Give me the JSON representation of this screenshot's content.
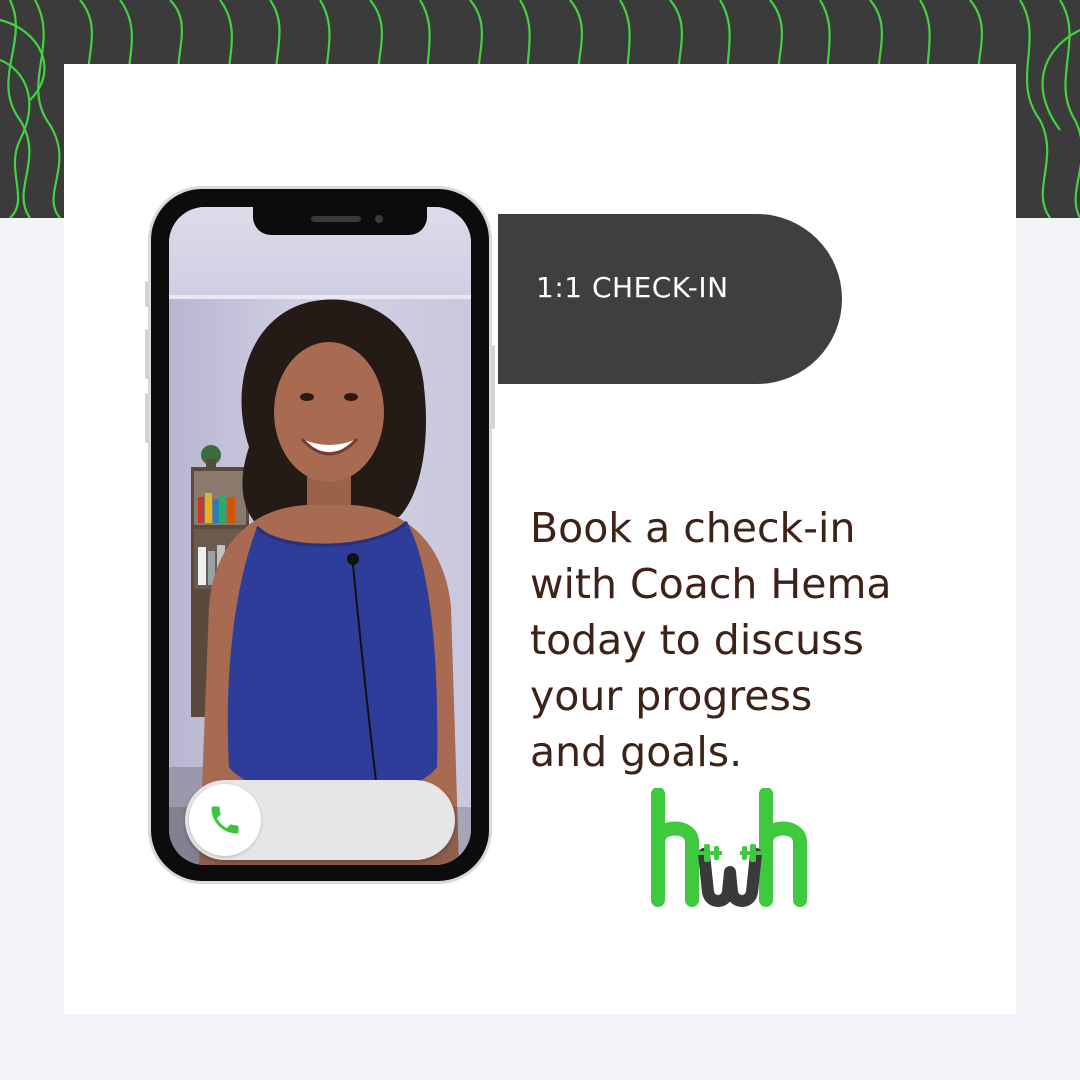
{
  "badge": {
    "label": "1:1 CHECK-IN"
  },
  "message": {
    "lines": [
      "Book a check-in",
      "with Coach Hema",
      "today to discuss",
      "your progress",
      "and goals."
    ]
  },
  "logo": {
    "text": "hwh",
    "alt": "hwh fitness logo"
  },
  "colors": {
    "accent_green": "#3ec93e",
    "dark_gray": "#3f3f3f",
    "text_brown": "#3d2218",
    "background": "#f3f4f8",
    "phone_call_green": "#3cc43c"
  },
  "icons": {
    "call": "phone-icon",
    "decorative_pattern": "wavy-lines-pattern"
  }
}
